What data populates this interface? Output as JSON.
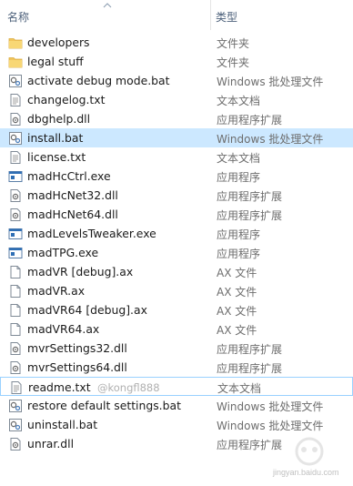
{
  "header": {
    "name_column": "名称",
    "type_column": "类型"
  },
  "files": [
    {
      "name": "developers",
      "type": "文件夹",
      "icon": "folder-icon"
    },
    {
      "name": "legal stuff",
      "type": "文件夹",
      "icon": "folder-icon"
    },
    {
      "name": "activate debug mode.bat",
      "type": "Windows 批处理文件",
      "icon": "batch-file-icon"
    },
    {
      "name": "changelog.txt",
      "type": "文本文档",
      "icon": "text-file-icon"
    },
    {
      "name": "dbghelp.dll",
      "type": "应用程序扩展",
      "icon": "dll-file-icon"
    },
    {
      "name": "install.bat",
      "type": "Windows 批处理文件",
      "icon": "batch-file-icon",
      "selected": true
    },
    {
      "name": "license.txt",
      "type": "文本文档",
      "icon": "text-file-icon"
    },
    {
      "name": "madHcCtrl.exe",
      "type": "应用程序",
      "icon": "exe-file-icon"
    },
    {
      "name": "madHcNet32.dll",
      "type": "应用程序扩展",
      "icon": "dll-file-icon"
    },
    {
      "name": "madHcNet64.dll",
      "type": "应用程序扩展",
      "icon": "dll-file-icon"
    },
    {
      "name": "madLevelsTweaker.exe",
      "type": "应用程序",
      "icon": "exe-file-icon"
    },
    {
      "name": "madTPG.exe",
      "type": "应用程序",
      "icon": "exe-file-icon"
    },
    {
      "name": "madVR [debug].ax",
      "type": "AX 文件",
      "icon": "blank-file-icon"
    },
    {
      "name": "madVR.ax",
      "type": "AX 文件",
      "icon": "blank-file-icon"
    },
    {
      "name": "madVR64 [debug].ax",
      "type": "AX 文件",
      "icon": "blank-file-icon"
    },
    {
      "name": "madVR64.ax",
      "type": "AX 文件",
      "icon": "blank-file-icon"
    },
    {
      "name": "mvrSettings32.dll",
      "type": "应用程序扩展",
      "icon": "dll-file-icon"
    },
    {
      "name": "mvrSettings64.dll",
      "type": "应用程序扩展",
      "icon": "dll-file-icon"
    },
    {
      "name": "readme.txt",
      "type": "文本文档",
      "icon": "text-file-icon",
      "focused": true,
      "overlay": "@kongfl888"
    },
    {
      "name": "restore default settings.bat",
      "type": "Windows 批处理文件",
      "icon": "batch-file-icon"
    },
    {
      "name": "uninstall.bat",
      "type": "Windows 批处理文件",
      "icon": "batch-file-icon"
    },
    {
      "name": "unrar.dll",
      "type": "应用程序扩展",
      "icon": "dll-file-icon"
    }
  ],
  "watermark": {
    "text": "jingyan.baidu.com"
  },
  "colors": {
    "selection": "#cce8ff",
    "focus_border": "#99d1ff",
    "folder": "#f2c55c"
  }
}
